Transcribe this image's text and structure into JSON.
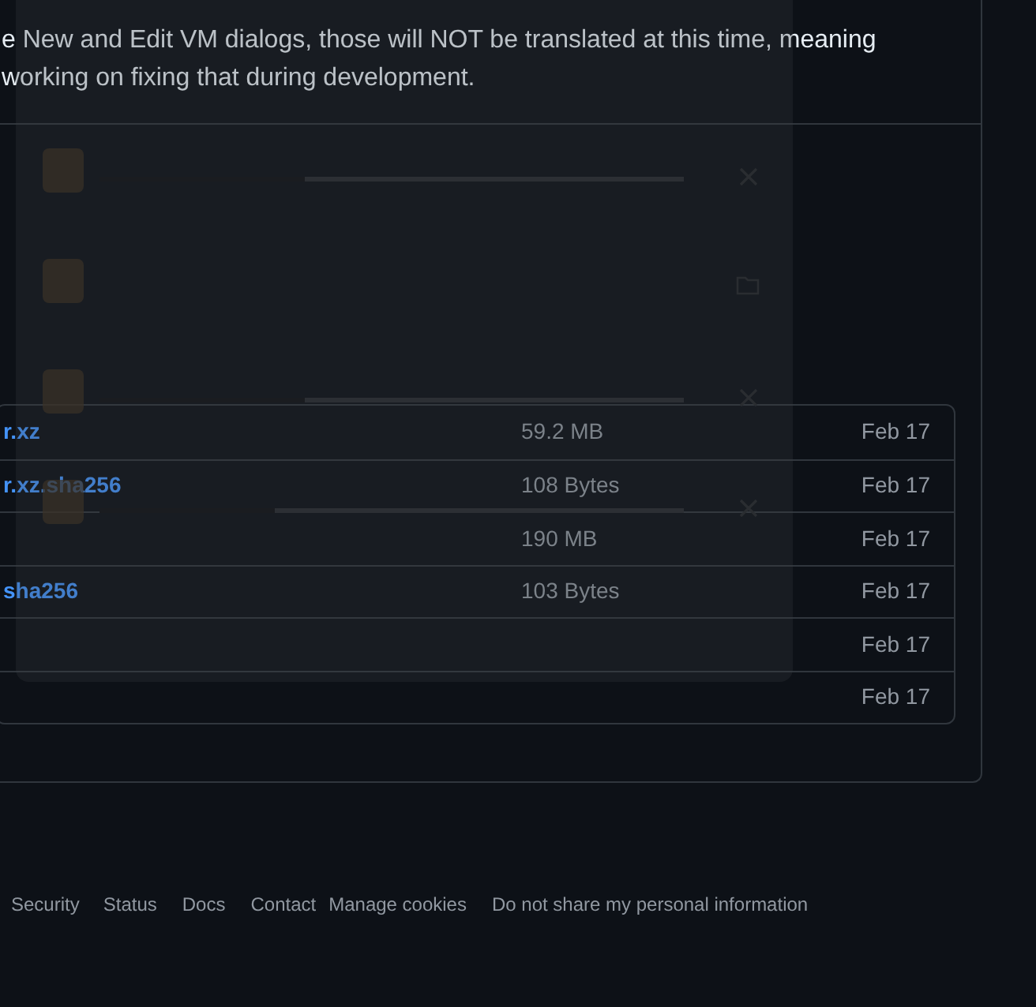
{
  "release_notes": {
    "lines": [
      "e New and Edit VM dialogs, those will NOT be translated at this time, meaning",
      "working on fixing that during development."
    ]
  },
  "assets": {
    "rows": [
      {
        "name": "r.xz",
        "size": "59.2 MB",
        "date": "Feb 17"
      },
      {
        "name": "r.xz.sha256",
        "size": "108 Bytes",
        "date": "Feb 17"
      },
      {
        "size": "190 MB",
        "date": "Feb 17"
      },
      {
        "name": "sha256",
        "size": "103 Bytes",
        "date": "Feb 17"
      },
      {
        "date": "Feb 17"
      },
      {
        "date": "Feb 17"
      }
    ]
  },
  "downloads_panel": {
    "items": [
      {
        "kind": "downloading",
        "level": 0.35
      },
      {
        "kind": "done"
      },
      {
        "kind": "downloading",
        "level": 0.35
      },
      {
        "kind": "downloading",
        "level": 0.3
      }
    ]
  },
  "footer": {
    "links": [
      "Security",
      "Status",
      "Docs",
      "Contact",
      "Manage cookies",
      "Do not share my personal information"
    ]
  }
}
